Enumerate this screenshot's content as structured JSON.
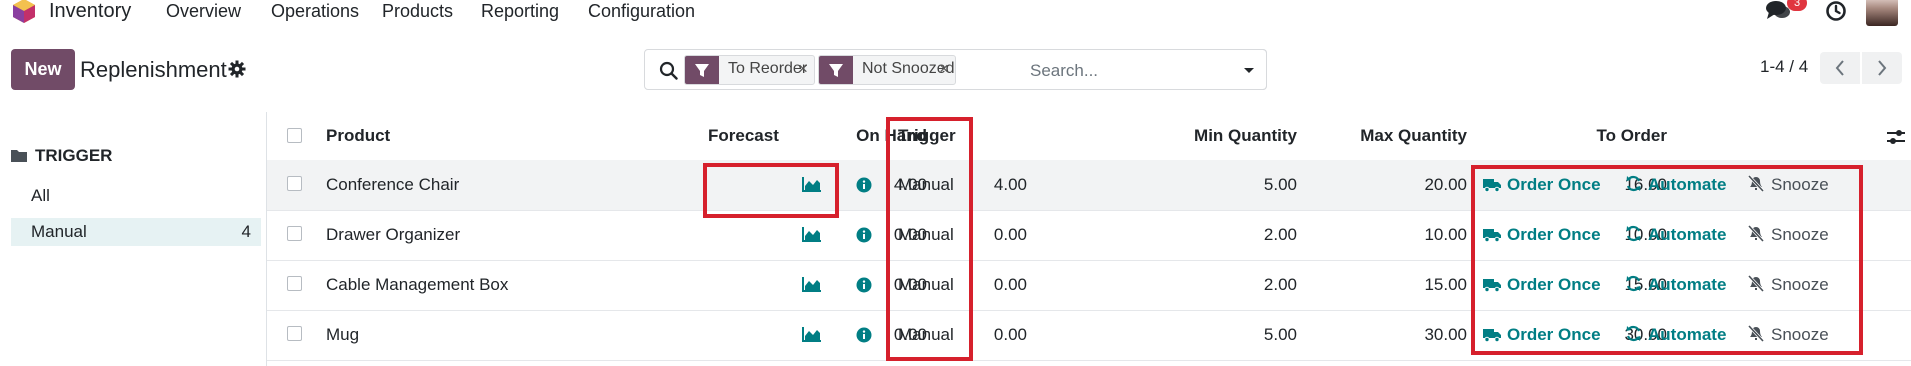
{
  "topbar": {
    "app_name": "Inventory",
    "menu": [
      "Overview",
      "Operations",
      "Products",
      "Reporting",
      "Configuration"
    ],
    "chat_badge": "3"
  },
  "control": {
    "new_label": "New",
    "title": "Replenishment",
    "facets": [
      {
        "label": "To Reorder"
      },
      {
        "label": "Not Snoozed"
      }
    ],
    "search_placeholder": "Search...",
    "pager": "1-4 / 4"
  },
  "sidebar": {
    "heading": "TRIGGER",
    "items": [
      {
        "label": "All",
        "count": ""
      },
      {
        "label": "Manual",
        "count": "4"
      }
    ]
  },
  "table": {
    "headers": {
      "product": "Product",
      "on_hand": "On Hand",
      "forecast": "Forecast",
      "trigger": "Trigger",
      "min_qty": "Min Quantity",
      "max_qty": "Max Quantity",
      "to_order": "To Order"
    },
    "rows": [
      {
        "product": "Conference Chair",
        "on_hand": "4.00",
        "forecast": "4.00",
        "trigger": "Manual",
        "min_qty": "5.00",
        "max_qty": "20.00",
        "to_order": "16.00"
      },
      {
        "product": "Drawer Organizer",
        "on_hand": "0.00",
        "forecast": "0.00",
        "trigger": "Manual",
        "min_qty": "2.00",
        "max_qty": "10.00",
        "to_order": "10.00"
      },
      {
        "product": "Cable Management Box",
        "on_hand": "0.00",
        "forecast": "0.00",
        "trigger": "Manual",
        "min_qty": "2.00",
        "max_qty": "15.00",
        "to_order": "15.00"
      },
      {
        "product": "Mug",
        "on_hand": "0.00",
        "forecast": "0.00",
        "trigger": "Manual",
        "min_qty": "5.00",
        "max_qty": "30.00",
        "to_order": "30.00"
      }
    ],
    "actions": {
      "order_once": "Order Once",
      "automate": "Automate",
      "snooze": "Snooze"
    }
  },
  "colors": {
    "brand": "#714b67",
    "accent": "#017e84",
    "highlight_box": "#d6202c"
  },
  "icons": [
    "app-logo-icon",
    "chat-icon",
    "clock-icon",
    "gear-icon",
    "search-icon",
    "filter-icon",
    "close-icon",
    "caret-down-icon",
    "chevron-left-icon",
    "chevron-right-icon",
    "folder-icon",
    "area-chart-icon",
    "info-icon",
    "truck-icon",
    "refresh-icon",
    "snooze-icon"
  ]
}
